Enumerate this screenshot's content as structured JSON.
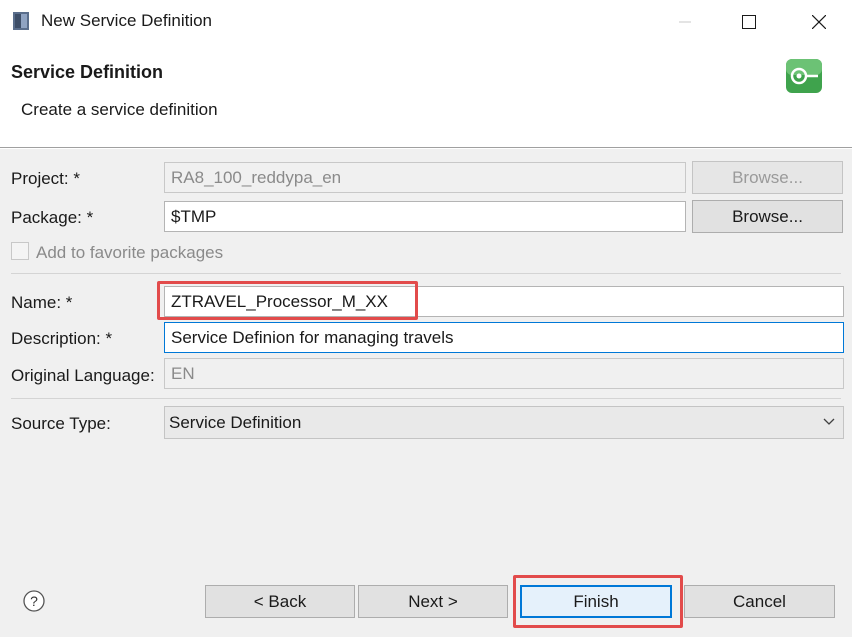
{
  "window": {
    "title": "New Service Definition",
    "controls": {
      "minimize": "—",
      "maximize": "☐",
      "close": "✕"
    }
  },
  "header": {
    "title": "Service Definition",
    "subtitle": "Create a service definition"
  },
  "form": {
    "project": {
      "label": "Project: *",
      "value": "RA8_100_reddypa_en",
      "browse_label": "Browse..."
    },
    "package": {
      "label": "Package: *",
      "value": "$TMP",
      "browse_label": "Browse..."
    },
    "favorite": {
      "label": "Add to favorite packages",
      "checked": false
    },
    "name": {
      "label": "Name: *",
      "value": "ZTRAVEL_Processor_M_XX"
    },
    "description": {
      "label": "Description: *",
      "value": "Service Definion for managing travels"
    },
    "original_language": {
      "label": "Original Language:",
      "value": "EN"
    },
    "source_type": {
      "label": "Source Type:",
      "value": "Service Definition"
    }
  },
  "footer": {
    "help_icon": "?",
    "back_label": "< Back",
    "next_label": "Next >",
    "finish_label": "Finish",
    "cancel_label": "Cancel"
  },
  "colors": {
    "highlight": "#e24b4b",
    "focus": "#0078d7",
    "wizard_icon": "#3fa34d"
  }
}
